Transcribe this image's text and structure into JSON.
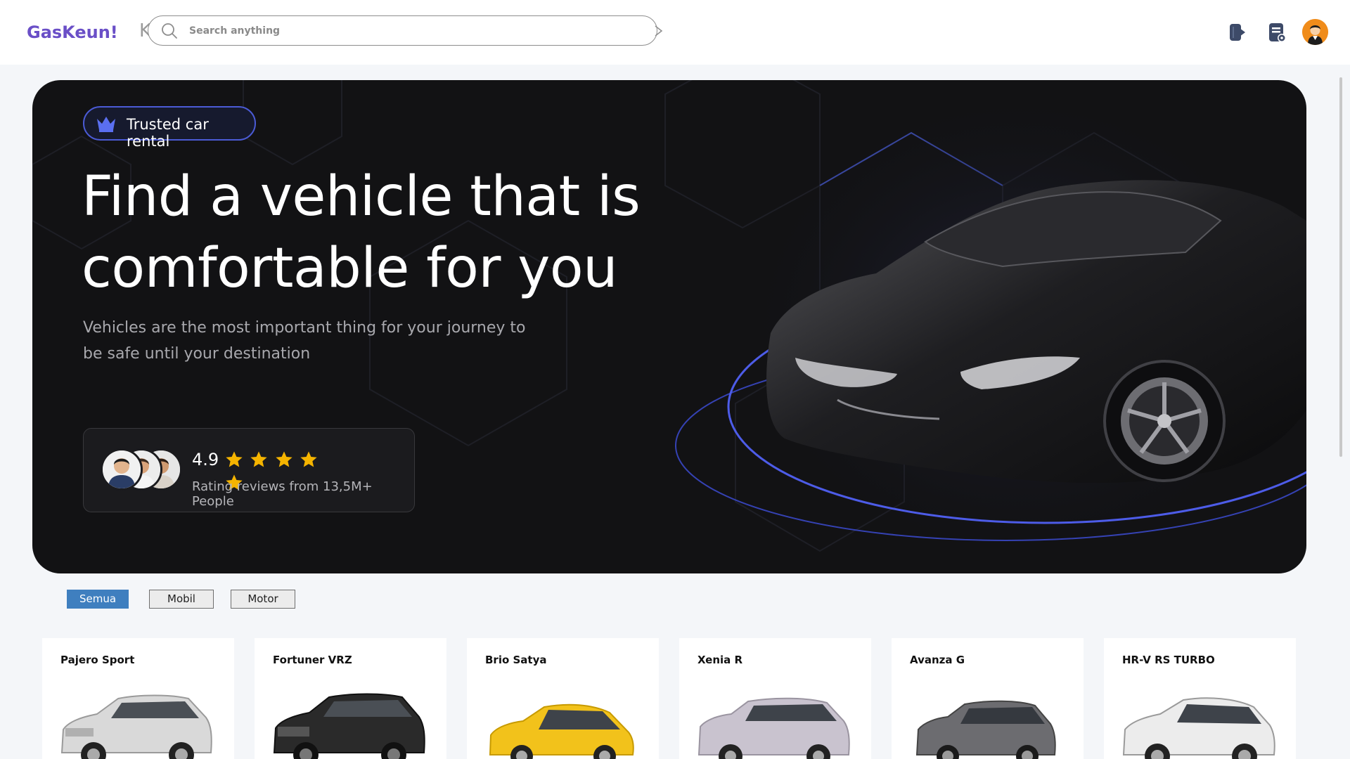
{
  "header": {
    "brand": "GasKeun!",
    "search_placeholder": "Search anything",
    "icons": [
      "logout-icon",
      "document-settings-icon",
      "user-avatar"
    ]
  },
  "hero": {
    "badge": "Trusted car rental",
    "title": "Find a vehicle that is comfortable for you",
    "description": "Vehicles are the most important thing for your journey to be safe until your destination",
    "rating": {
      "value": "4.9",
      "stars": 5,
      "text": "Rating reviews from 13,5M+ People"
    }
  },
  "filters": [
    {
      "label": "Semua",
      "active": true
    },
    {
      "label": "Mobil",
      "active": false
    },
    {
      "label": "Motor",
      "active": false
    }
  ],
  "cars": [
    {
      "name": "Pajero Sport",
      "color": "#d9d9d9"
    },
    {
      "name": "Fortuner VRZ",
      "color": "#2a2a2a"
    },
    {
      "name": "Brio Satya",
      "color": "#f2c21b"
    },
    {
      "name": "Xenia R",
      "color": "#c9c3cf"
    },
    {
      "name": "Avanza G",
      "color": "#6c6c70"
    },
    {
      "name": "HR-V RS TURBO",
      "color": "#ececec"
    }
  ],
  "colors": {
    "brand": "#6a4fc7",
    "accent_blue": "#4b5bd6",
    "star": "#f5b400",
    "active_filter": "#3f7fbf"
  }
}
